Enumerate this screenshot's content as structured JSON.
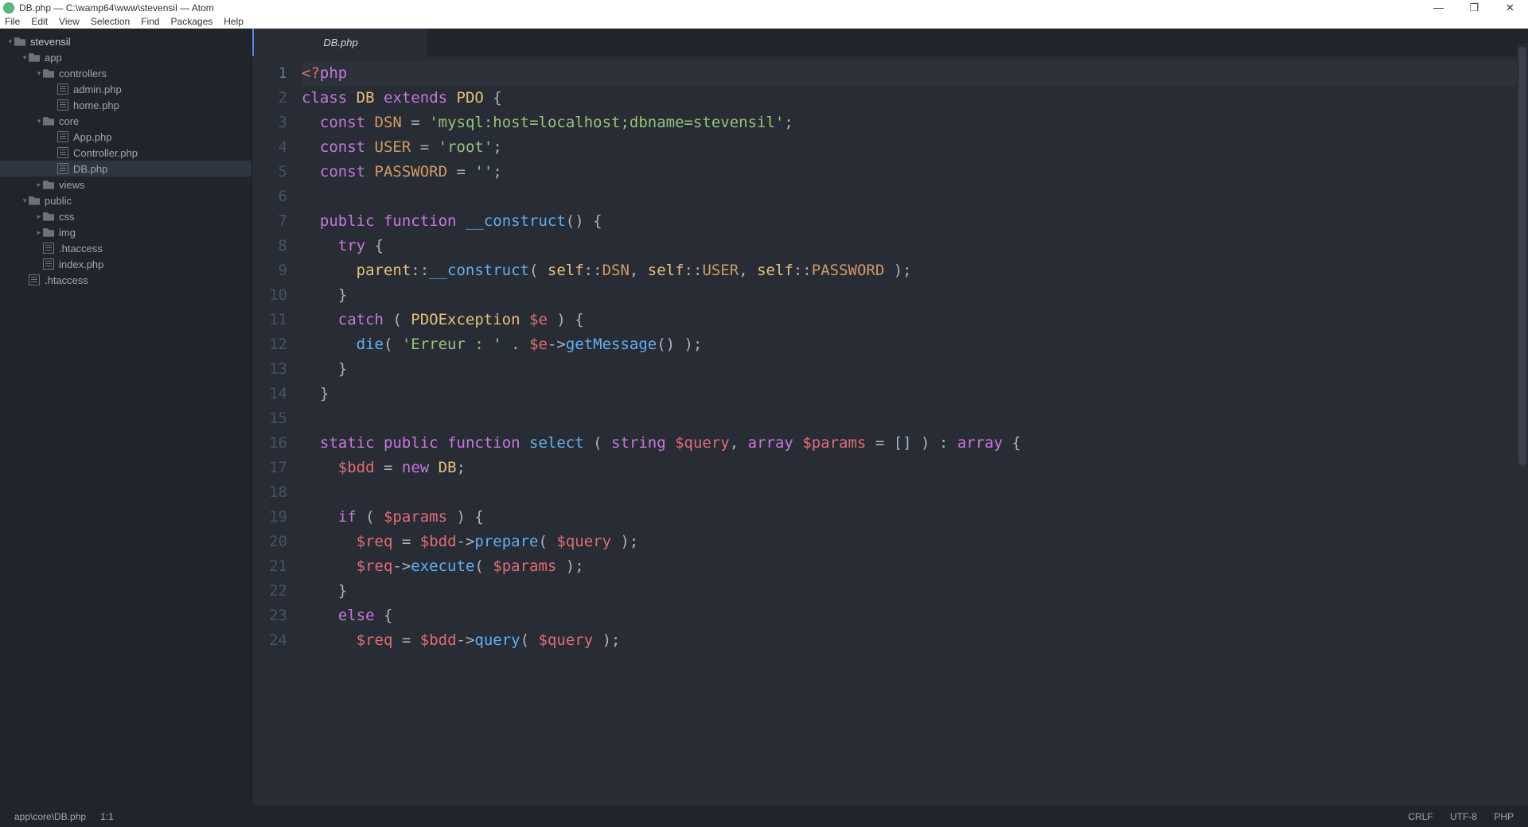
{
  "window": {
    "title": "DB.php — C:\\wamp64\\www\\stevensil — Atom"
  },
  "menubar": [
    "File",
    "Edit",
    "View",
    "Selection",
    "Find",
    "Packages",
    "Help"
  ],
  "tree": [
    {
      "d": 0,
      "t": "folder",
      "open": true,
      "name": "stevensil",
      "root": true
    },
    {
      "d": 1,
      "t": "folder",
      "open": true,
      "name": "app"
    },
    {
      "d": 2,
      "t": "folder",
      "open": true,
      "name": "controllers"
    },
    {
      "d": 3,
      "t": "file",
      "name": "admin.php"
    },
    {
      "d": 3,
      "t": "file",
      "name": "home.php"
    },
    {
      "d": 2,
      "t": "folder",
      "open": true,
      "name": "core"
    },
    {
      "d": 3,
      "t": "file",
      "name": "App.php"
    },
    {
      "d": 3,
      "t": "file",
      "name": "Controller.php"
    },
    {
      "d": 3,
      "t": "file",
      "name": "DB.php",
      "sel": true
    },
    {
      "d": 2,
      "t": "folder",
      "open": false,
      "name": "views"
    },
    {
      "d": 1,
      "t": "folder",
      "open": true,
      "name": "public"
    },
    {
      "d": 2,
      "t": "folder",
      "open": false,
      "name": "css"
    },
    {
      "d": 2,
      "t": "folder",
      "open": false,
      "name": "img"
    },
    {
      "d": 2,
      "t": "file",
      "name": ".htaccess"
    },
    {
      "d": 2,
      "t": "file",
      "name": "index.php"
    },
    {
      "d": 1,
      "t": "file",
      "name": ".htaccess"
    }
  ],
  "tab": {
    "label": "DB.php"
  },
  "code": [
    [
      [
        "php",
        "<?"
      ],
      [
        "phpq",
        "php"
      ]
    ],
    [
      [
        "kw",
        "class"
      ],
      [
        "p",
        " "
      ],
      [
        "cls",
        "DB"
      ],
      [
        "p",
        " "
      ],
      [
        "kw",
        "extends"
      ],
      [
        "p",
        " "
      ],
      [
        "cls",
        "PDO"
      ],
      [
        "p",
        " {"
      ]
    ],
    [
      [
        "p",
        "  "
      ],
      [
        "kw",
        "const"
      ],
      [
        "p",
        " "
      ],
      [
        "cnst",
        "DSN"
      ],
      [
        "p",
        " "
      ],
      [
        "op",
        "="
      ],
      [
        "p",
        " "
      ],
      [
        "str",
        "'mysql:host=localhost;dbname=stevensil'"
      ],
      [
        "p",
        ";"
      ]
    ],
    [
      [
        "p",
        "  "
      ],
      [
        "kw",
        "const"
      ],
      [
        "p",
        " "
      ],
      [
        "cnst",
        "USER"
      ],
      [
        "p",
        " "
      ],
      [
        "op",
        "="
      ],
      [
        "p",
        " "
      ],
      [
        "str",
        "'root'"
      ],
      [
        "p",
        ";"
      ]
    ],
    [
      [
        "p",
        "  "
      ],
      [
        "kw",
        "const"
      ],
      [
        "p",
        " "
      ],
      [
        "cnst",
        "PASSWORD"
      ],
      [
        "p",
        " "
      ],
      [
        "op",
        "="
      ],
      [
        "p",
        " "
      ],
      [
        "str",
        "''"
      ],
      [
        "p",
        ";"
      ]
    ],
    [],
    [
      [
        "p",
        "  "
      ],
      [
        "kw",
        "public"
      ],
      [
        "p",
        " "
      ],
      [
        "kw",
        "function"
      ],
      [
        "p",
        " "
      ],
      [
        "fn",
        "__construct"
      ],
      [
        "p",
        "() {"
      ]
    ],
    [
      [
        "p",
        "    "
      ],
      [
        "kw",
        "try"
      ],
      [
        "p",
        " {"
      ]
    ],
    [
      [
        "p",
        "      "
      ],
      [
        "cls",
        "parent"
      ],
      [
        "op",
        "::"
      ],
      [
        "fn",
        "__construct"
      ],
      [
        "p",
        "( "
      ],
      [
        "cls",
        "self"
      ],
      [
        "op",
        "::"
      ],
      [
        "cnst",
        "DSN"
      ],
      [
        "p",
        ", "
      ],
      [
        "cls",
        "self"
      ],
      [
        "op",
        "::"
      ],
      [
        "cnst",
        "USER"
      ],
      [
        "p",
        ", "
      ],
      [
        "cls",
        "self"
      ],
      [
        "op",
        "::"
      ],
      [
        "cnst",
        "PASSWORD"
      ],
      [
        "p",
        " );"
      ]
    ],
    [
      [
        "p",
        "    }"
      ]
    ],
    [
      [
        "p",
        "    "
      ],
      [
        "kw",
        "catch"
      ],
      [
        "p",
        " ( "
      ],
      [
        "cls",
        "PDOException"
      ],
      [
        "p",
        " "
      ],
      [
        "var",
        "$e"
      ],
      [
        "p",
        " ) {"
      ]
    ],
    [
      [
        "p",
        "      "
      ],
      [
        "fn",
        "die"
      ],
      [
        "p",
        "( "
      ],
      [
        "str",
        "'Erreur : '"
      ],
      [
        "p",
        " "
      ],
      [
        "op",
        "."
      ],
      [
        "p",
        " "
      ],
      [
        "var",
        "$e"
      ],
      [
        "op",
        "->"
      ],
      [
        "fn",
        "getMessage"
      ],
      [
        "p",
        "() );"
      ]
    ],
    [
      [
        "p",
        "    }"
      ]
    ],
    [
      [
        "p",
        "  }"
      ]
    ],
    [],
    [
      [
        "p",
        "  "
      ],
      [
        "kw",
        "static"
      ],
      [
        "p",
        " "
      ],
      [
        "kw",
        "public"
      ],
      [
        "p",
        " "
      ],
      [
        "kw",
        "function"
      ],
      [
        "p",
        " "
      ],
      [
        "fn",
        "select"
      ],
      [
        "p",
        " ( "
      ],
      [
        "kw",
        "string"
      ],
      [
        "p",
        " "
      ],
      [
        "var",
        "$query"
      ],
      [
        "p",
        ", "
      ],
      [
        "kw",
        "array"
      ],
      [
        "p",
        " "
      ],
      [
        "var",
        "$params"
      ],
      [
        "p",
        " "
      ],
      [
        "op",
        "="
      ],
      [
        "p",
        " [] ) "
      ],
      [
        "op",
        ":"
      ],
      [
        "p",
        " "
      ],
      [
        "kw",
        "array"
      ],
      [
        "p",
        " {"
      ]
    ],
    [
      [
        "p",
        "    "
      ],
      [
        "var",
        "$bdd"
      ],
      [
        "p",
        " "
      ],
      [
        "op",
        "="
      ],
      [
        "p",
        " "
      ],
      [
        "kw",
        "new"
      ],
      [
        "p",
        " "
      ],
      [
        "cls",
        "DB"
      ],
      [
        "p",
        ";"
      ]
    ],
    [],
    [
      [
        "p",
        "    "
      ],
      [
        "kw",
        "if"
      ],
      [
        "p",
        " ( "
      ],
      [
        "var",
        "$params"
      ],
      [
        "p",
        " ) {"
      ]
    ],
    [
      [
        "p",
        "      "
      ],
      [
        "var",
        "$req"
      ],
      [
        "p",
        " "
      ],
      [
        "op",
        "="
      ],
      [
        "p",
        " "
      ],
      [
        "var",
        "$bdd"
      ],
      [
        "op",
        "->"
      ],
      [
        "fn",
        "prepare"
      ],
      [
        "p",
        "( "
      ],
      [
        "var",
        "$query"
      ],
      [
        "p",
        " );"
      ]
    ],
    [
      [
        "p",
        "      "
      ],
      [
        "var",
        "$req"
      ],
      [
        "op",
        "->"
      ],
      [
        "fn",
        "execute"
      ],
      [
        "p",
        "( "
      ],
      [
        "var",
        "$params"
      ],
      [
        "p",
        " );"
      ]
    ],
    [
      [
        "p",
        "    }"
      ]
    ],
    [
      [
        "p",
        "    "
      ],
      [
        "kw",
        "else"
      ],
      [
        "p",
        " {"
      ]
    ],
    [
      [
        "p",
        "      "
      ],
      [
        "var",
        "$req"
      ],
      [
        "p",
        " "
      ],
      [
        "op",
        "="
      ],
      [
        "p",
        " "
      ],
      [
        "var",
        "$bdd"
      ],
      [
        "op",
        "->"
      ],
      [
        "fn",
        "query"
      ],
      [
        "p",
        "( "
      ],
      [
        "var",
        "$query"
      ],
      [
        "p",
        " );"
      ]
    ]
  ],
  "current_line": 1,
  "status": {
    "path": "app\\core\\DB.php",
    "pos": "1:1",
    "eol": "CRLF",
    "enc": "UTF-8",
    "lang": "PHP"
  }
}
